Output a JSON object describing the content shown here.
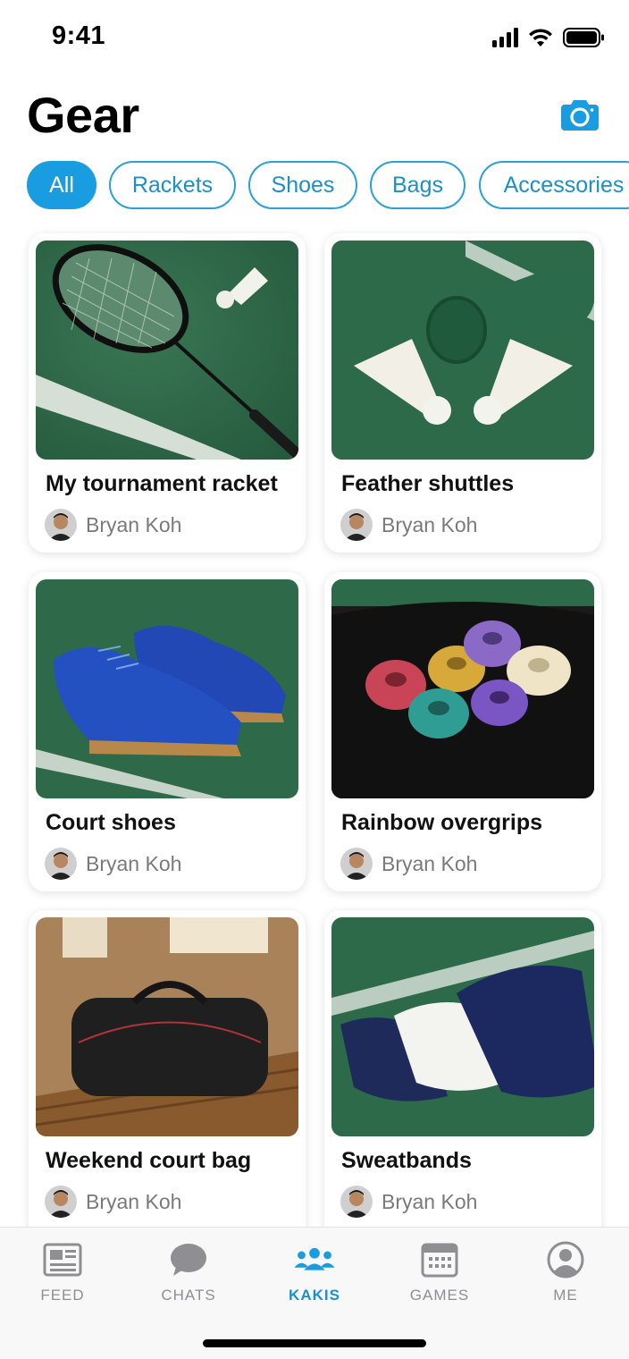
{
  "status_bar": {
    "time": "9:41"
  },
  "header": {
    "title": "Gear",
    "camera_icon": "camera-icon"
  },
  "filters": {
    "selected": "All",
    "chips": [
      "All",
      "Rackets",
      "Shoes",
      "Bags",
      "Accessories"
    ]
  },
  "items": [
    {
      "title": "My tournament racket",
      "author": "Bryan Koh",
      "image": "racket-photo"
    },
    {
      "title": "Feather shuttles",
      "author": "Bryan Koh",
      "image": "shuttles-photo"
    },
    {
      "title": "Court shoes",
      "author": "Bryan Koh",
      "image": "shoes-photo"
    },
    {
      "title": "Rainbow overgrips",
      "author": "Bryan Koh",
      "image": "overgrips-photo"
    },
    {
      "title": "Weekend court bag",
      "author": "Bryan Koh",
      "image": "bag-photo"
    },
    {
      "title": "Sweatbands",
      "author": "Bryan Koh",
      "image": "sweatbands-photo"
    }
  ],
  "tabs": [
    {
      "label": "FEED",
      "icon": "newspaper-icon",
      "active": false
    },
    {
      "label": "CHATS",
      "icon": "chat-bubble-icon",
      "active": false
    },
    {
      "label": "KAKIS",
      "icon": "people-group-icon",
      "active": true
    },
    {
      "label": "GAMES",
      "icon": "calendar-icon",
      "active": false
    },
    {
      "label": "ME",
      "icon": "user-circle-icon",
      "active": false
    }
  ],
  "colors": {
    "accent": "#1a9de0",
    "inactive": "#8e8e93",
    "court_green": "#2f6b4a"
  }
}
